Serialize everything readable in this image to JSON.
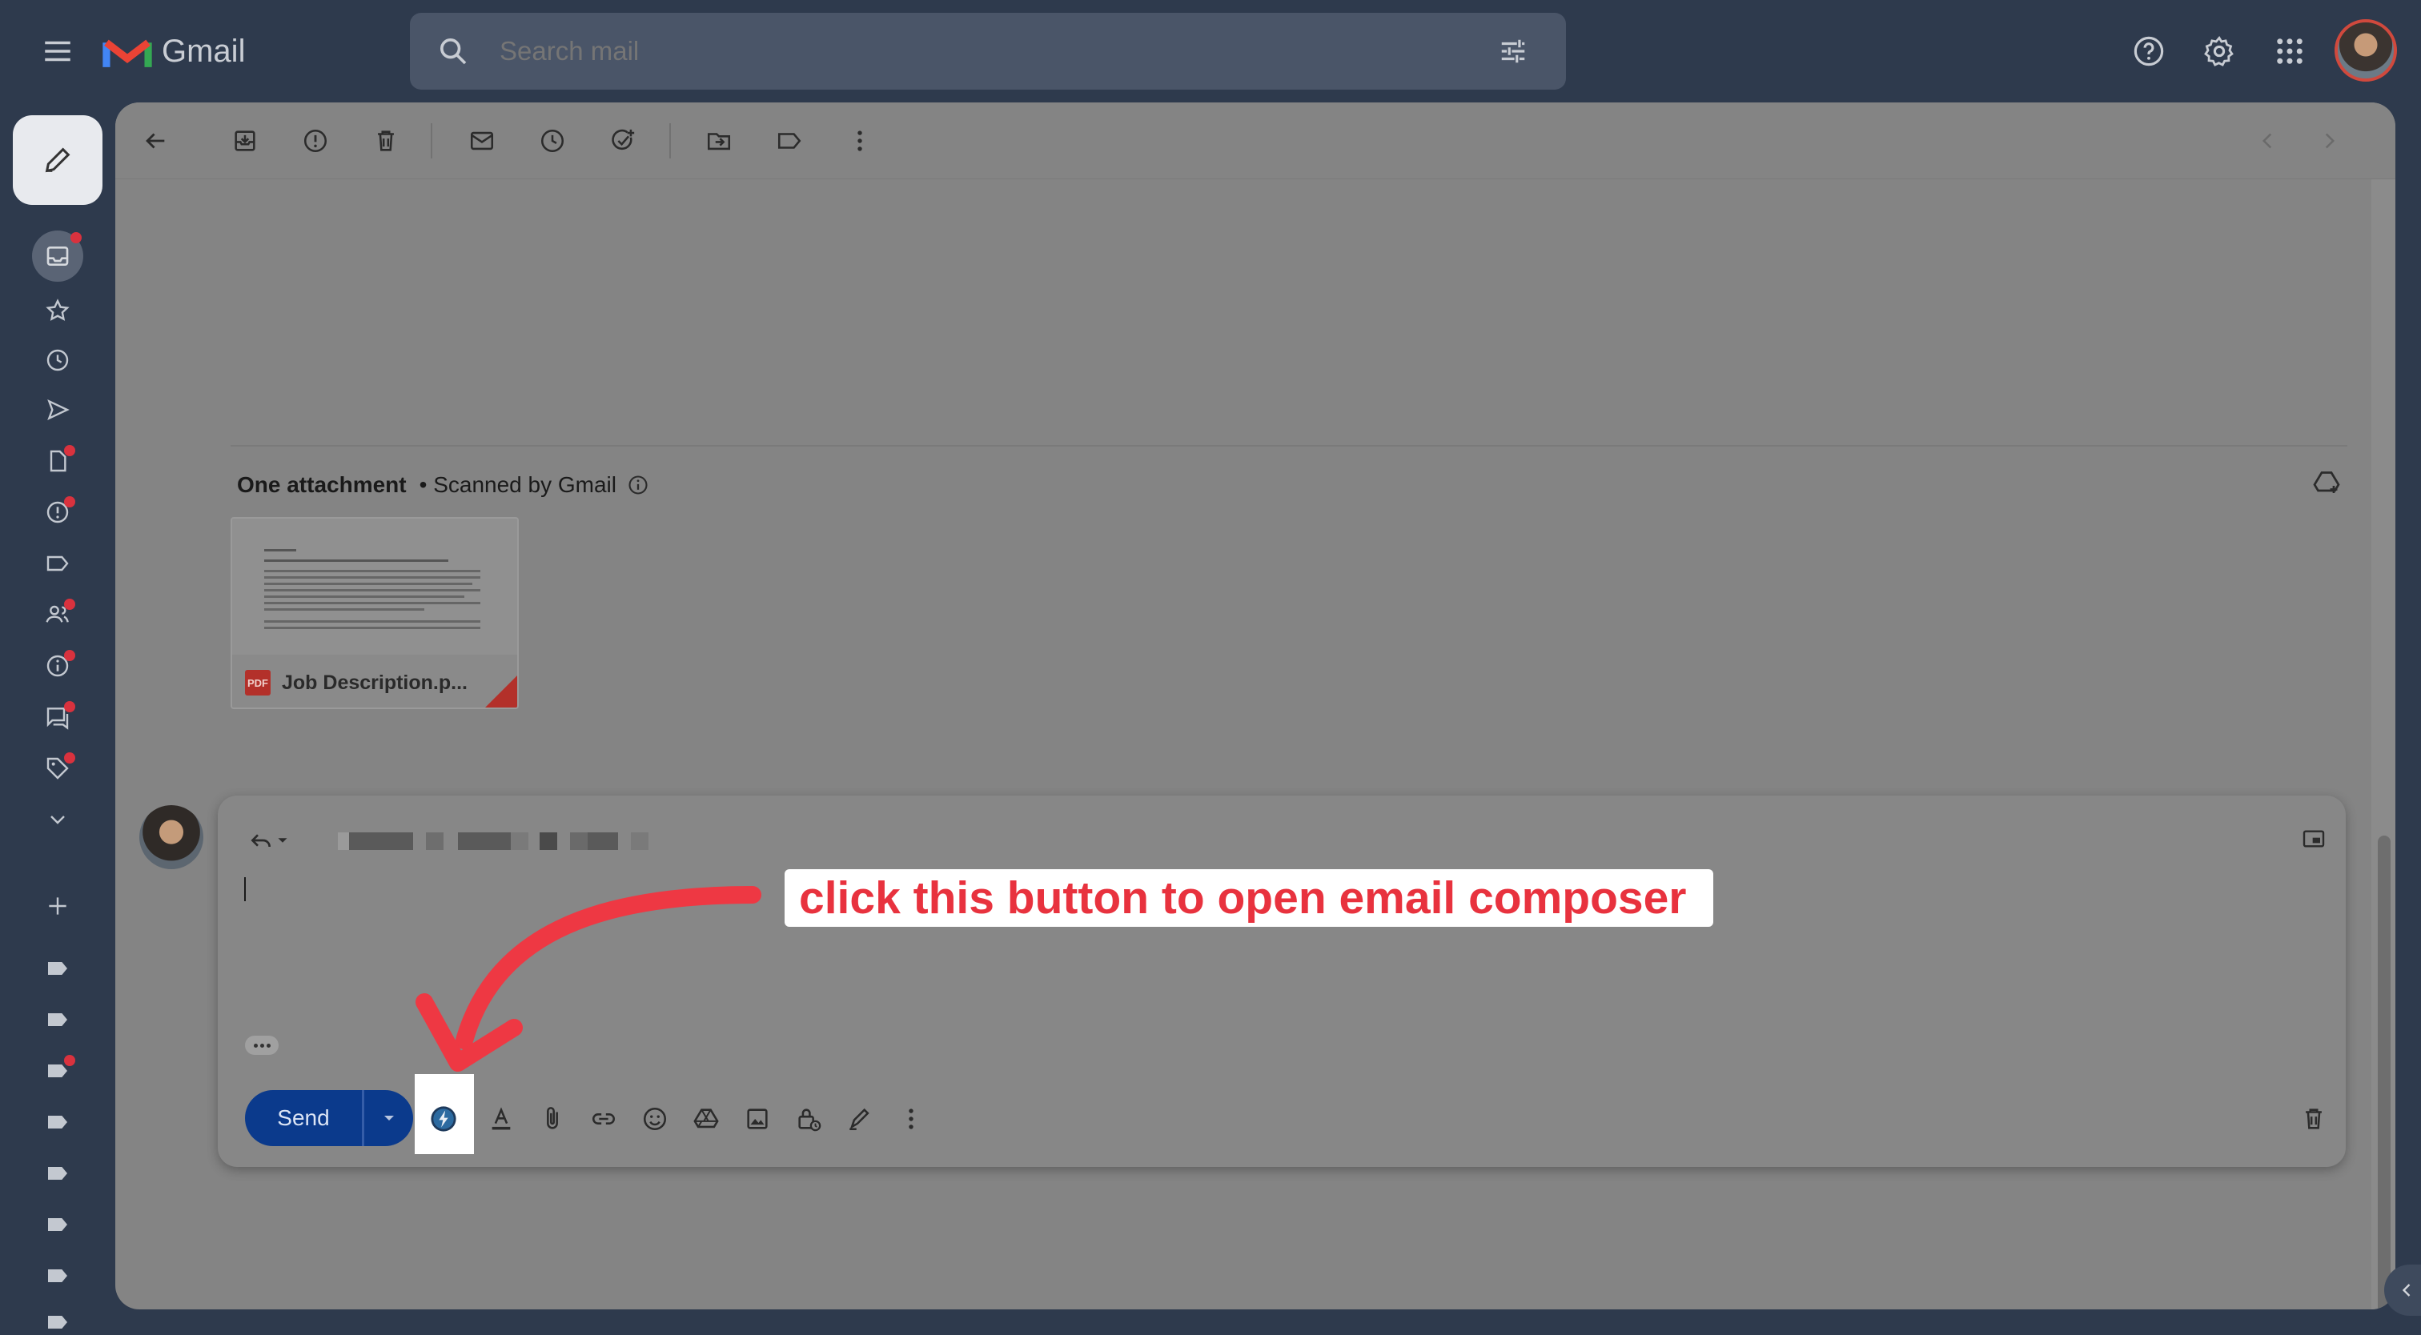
{
  "app": {
    "name": "Gmail",
    "brand_color": "#ea4335",
    "background": "#2e3a4d"
  },
  "search": {
    "placeholder": "Search mail"
  },
  "topbar_icons": [
    "menu-icon",
    "help-icon",
    "settings-icon",
    "apps-icon",
    "avatar"
  ],
  "toolbar": {
    "icons": [
      "back-arrow-icon",
      "archive-icon",
      "report-spam-icon",
      "delete-icon",
      "mark-unread-icon",
      "snooze-icon",
      "add-task-icon",
      "move-to-icon",
      "label-icon",
      "more-vert-icon",
      "prev-icon",
      "next-icon"
    ]
  },
  "sidebar": {
    "items": [
      "inbox-icon",
      "starred-icon",
      "snoozed-icon",
      "sent-icon",
      "drafts-icon",
      "spam-icon",
      "label-icon",
      "contacts-icon",
      "info-icon",
      "chat-icon",
      "tag-icon",
      "more-icon",
      "add-label-icon"
    ],
    "unread_dot_color": "#d9323e"
  },
  "attachments": {
    "heading": "One attachment",
    "scan_note": "• Scanned by Gmail",
    "file": {
      "name": "Job Description.p...",
      "type_badge": "PDF"
    }
  },
  "reply": {
    "send_label": "Send",
    "send_color": "#0b3a8c",
    "format_icons": [
      "quick-reply-icon",
      "formatting-icon",
      "attach-icon",
      "link-icon",
      "emoji-icon",
      "drive-icon",
      "photo-icon",
      "confidential-icon",
      "signature-icon",
      "more-options-icon"
    ]
  },
  "annotation": {
    "text": "click this button to open email composer",
    "color": "#e8323e"
  }
}
